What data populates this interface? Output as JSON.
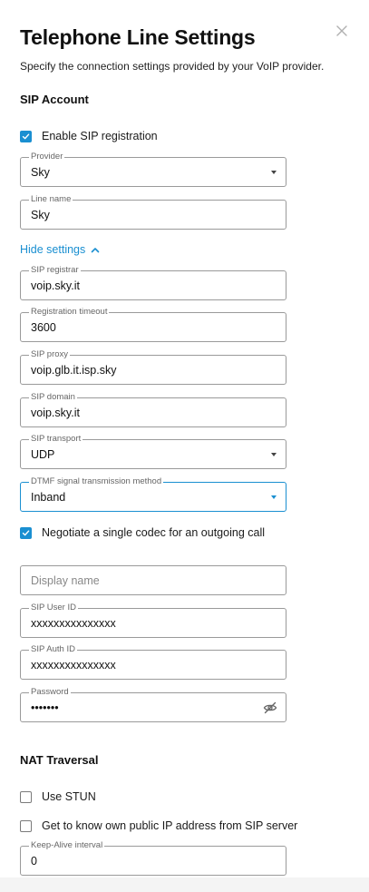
{
  "dialog": {
    "title": "Telephone Line Settings",
    "subtitle": "Specify the connection settings provided by your VoIP provider."
  },
  "sip_account": {
    "heading": "SIP Account",
    "enable_registration": {
      "label": "Enable SIP registration",
      "checked": true
    },
    "provider": {
      "label": "Provider",
      "value": "Sky"
    },
    "line_name": {
      "label": "Line name",
      "value": "Sky"
    },
    "toggle_settings_label": "Hide settings",
    "sip_registrar": {
      "label": "SIP registrar",
      "value": "voip.sky.it"
    },
    "registration_timeout": {
      "label": "Registration timeout",
      "value": "3600"
    },
    "sip_proxy": {
      "label": "SIP proxy",
      "value": "voip.glb.it.isp.sky"
    },
    "sip_domain": {
      "label": "SIP domain",
      "value": "voip.sky.it"
    },
    "sip_transport": {
      "label": "SIP transport",
      "value": "UDP"
    },
    "dtmf_method": {
      "label": "DTMF signal transmission method",
      "value": "Inband"
    },
    "single_codec": {
      "label": "Negotiate a single codec for an outgoing call",
      "checked": true
    },
    "display_name": {
      "placeholder": "Display name",
      "value": ""
    },
    "sip_user_id": {
      "label": "SIP User ID",
      "value": "xxxxxxxxxxxxxxx"
    },
    "sip_auth_id": {
      "label": "SIP Auth ID",
      "value": "xxxxxxxxxxxxxxx"
    },
    "password": {
      "label": "Password",
      "value": "•••••••"
    }
  },
  "nat_traversal": {
    "heading": "NAT Traversal",
    "use_stun": {
      "label": "Use STUN",
      "checked": false
    },
    "public_ip_from_server": {
      "label": "Get to know own public IP address from SIP server",
      "checked": false
    },
    "keep_alive": {
      "label": "Keep-Alive interval",
      "value": "0"
    }
  },
  "colors": {
    "accent": "#1a8fd1",
    "border": "#9a9a9a",
    "text": "#1a1a1a"
  }
}
